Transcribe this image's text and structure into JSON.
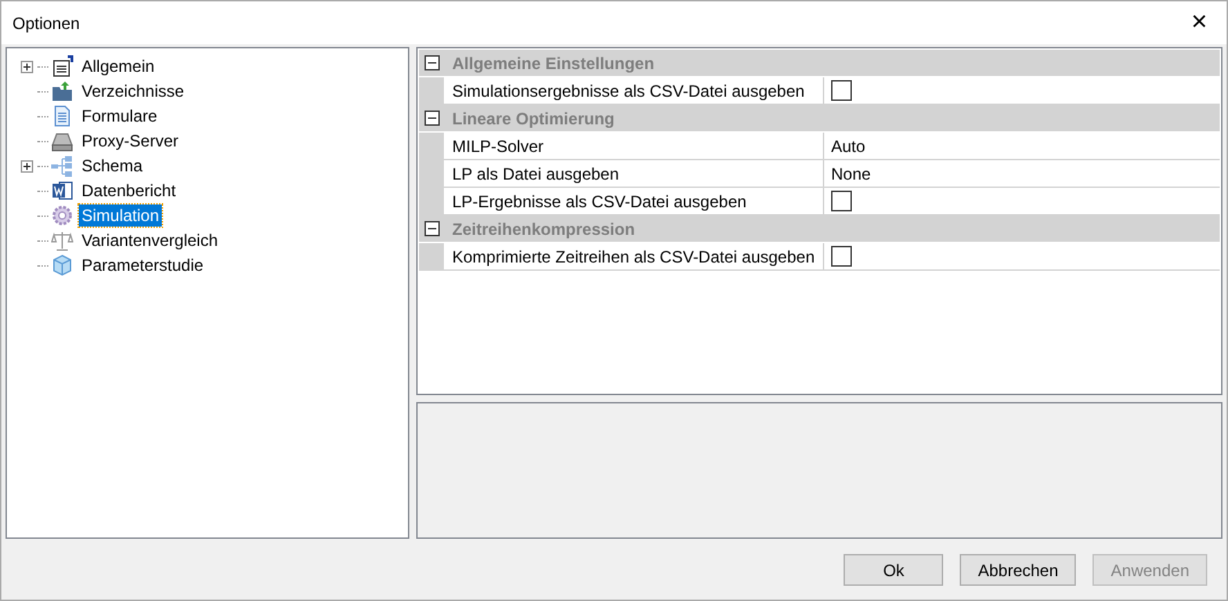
{
  "window": {
    "title": "Optionen",
    "close": "×"
  },
  "tree": [
    {
      "label": "Allgemein",
      "kind": "settings",
      "expandable": true,
      "selected": false
    },
    {
      "label": "Verzeichnisse",
      "kind": "folder",
      "expandable": false,
      "selected": false
    },
    {
      "label": "Formulare",
      "kind": "document",
      "expandable": false,
      "selected": false
    },
    {
      "label": "Proxy-Server",
      "kind": "server",
      "expandable": false,
      "selected": false
    },
    {
      "label": "Schema",
      "kind": "schema",
      "expandable": true,
      "selected": false
    },
    {
      "label": "Datenbericht",
      "kind": "word",
      "expandable": false,
      "selected": false
    },
    {
      "label": "Simulation",
      "kind": "gear",
      "expandable": false,
      "selected": true
    },
    {
      "label": "Variantenvergleich",
      "kind": "scale",
      "expandable": false,
      "selected": false
    },
    {
      "label": "Parameterstudie",
      "kind": "cube",
      "expandable": false,
      "selected": false
    }
  ],
  "property_grid": [
    {
      "category": "Allgemeine Einstellungen",
      "expanded": true,
      "rows": [
        {
          "label": "Simulationsergebnisse als CSV-Datei ausgeben",
          "kind": "checkbox",
          "checked": false
        }
      ]
    },
    {
      "category": "Lineare Optimierung",
      "expanded": true,
      "rows": [
        {
          "label": "MILP-Solver",
          "kind": "text",
          "value": "Auto"
        },
        {
          "label": "LP als Datei ausgeben",
          "kind": "text",
          "value": "None"
        },
        {
          "label": "LP-Ergebnisse als CSV-Datei ausgeben",
          "kind": "checkbox",
          "checked": false
        }
      ]
    },
    {
      "category": "Zeitreihenkompression",
      "expanded": true,
      "rows": [
        {
          "label": "Komprimierte Zeitreihen als CSV-Datei ausgeben",
          "kind": "checkbox",
          "checked": false
        }
      ]
    }
  ],
  "buttons": [
    {
      "label": "Ok",
      "disabled": false
    },
    {
      "label": "Abbrechen",
      "disabled": false
    },
    {
      "label": "Anwenden",
      "disabled": true
    }
  ]
}
